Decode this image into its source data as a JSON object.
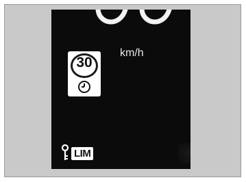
{
  "display": {
    "speed_unit": "km/h",
    "speed_limit_sign": {
      "value": "30",
      "icon": "clock-icon"
    },
    "limiter_indicator": {
      "label": "LIM",
      "icon": "key-icon"
    }
  },
  "colors": {
    "background": "#c9c9c9",
    "screen": "#0b0b0b",
    "foreground": "#ffffff"
  }
}
